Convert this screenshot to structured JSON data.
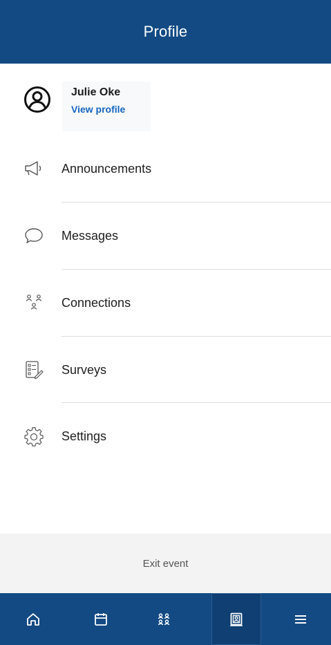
{
  "header": {
    "title": "Profile"
  },
  "profile": {
    "name": "Julie Oke",
    "link_label": "View profile",
    "avatar_icon": "user-circle-icon"
  },
  "menu": {
    "items": [
      {
        "label": "Announcements",
        "icon": "megaphone-icon"
      },
      {
        "label": "Messages",
        "icon": "chat-bubble-icon"
      },
      {
        "label": "Connections",
        "icon": "people-network-icon"
      },
      {
        "label": "Surveys",
        "icon": "survey-clipboard-icon"
      },
      {
        "label": "Settings",
        "icon": "gear-icon"
      }
    ]
  },
  "footer": {
    "exit_label": "Exit event"
  },
  "bottom_nav": {
    "items": [
      {
        "icon": "home-icon",
        "active": false
      },
      {
        "icon": "calendar-icon",
        "active": false
      },
      {
        "icon": "people-icon",
        "active": false
      },
      {
        "icon": "profile-badge-icon",
        "active": true
      },
      {
        "icon": "hamburger-menu-icon",
        "active": false
      }
    ]
  },
  "colors": {
    "brand": "#134a83",
    "link": "#1565c0",
    "exit_bg": "#f3f3f3"
  }
}
